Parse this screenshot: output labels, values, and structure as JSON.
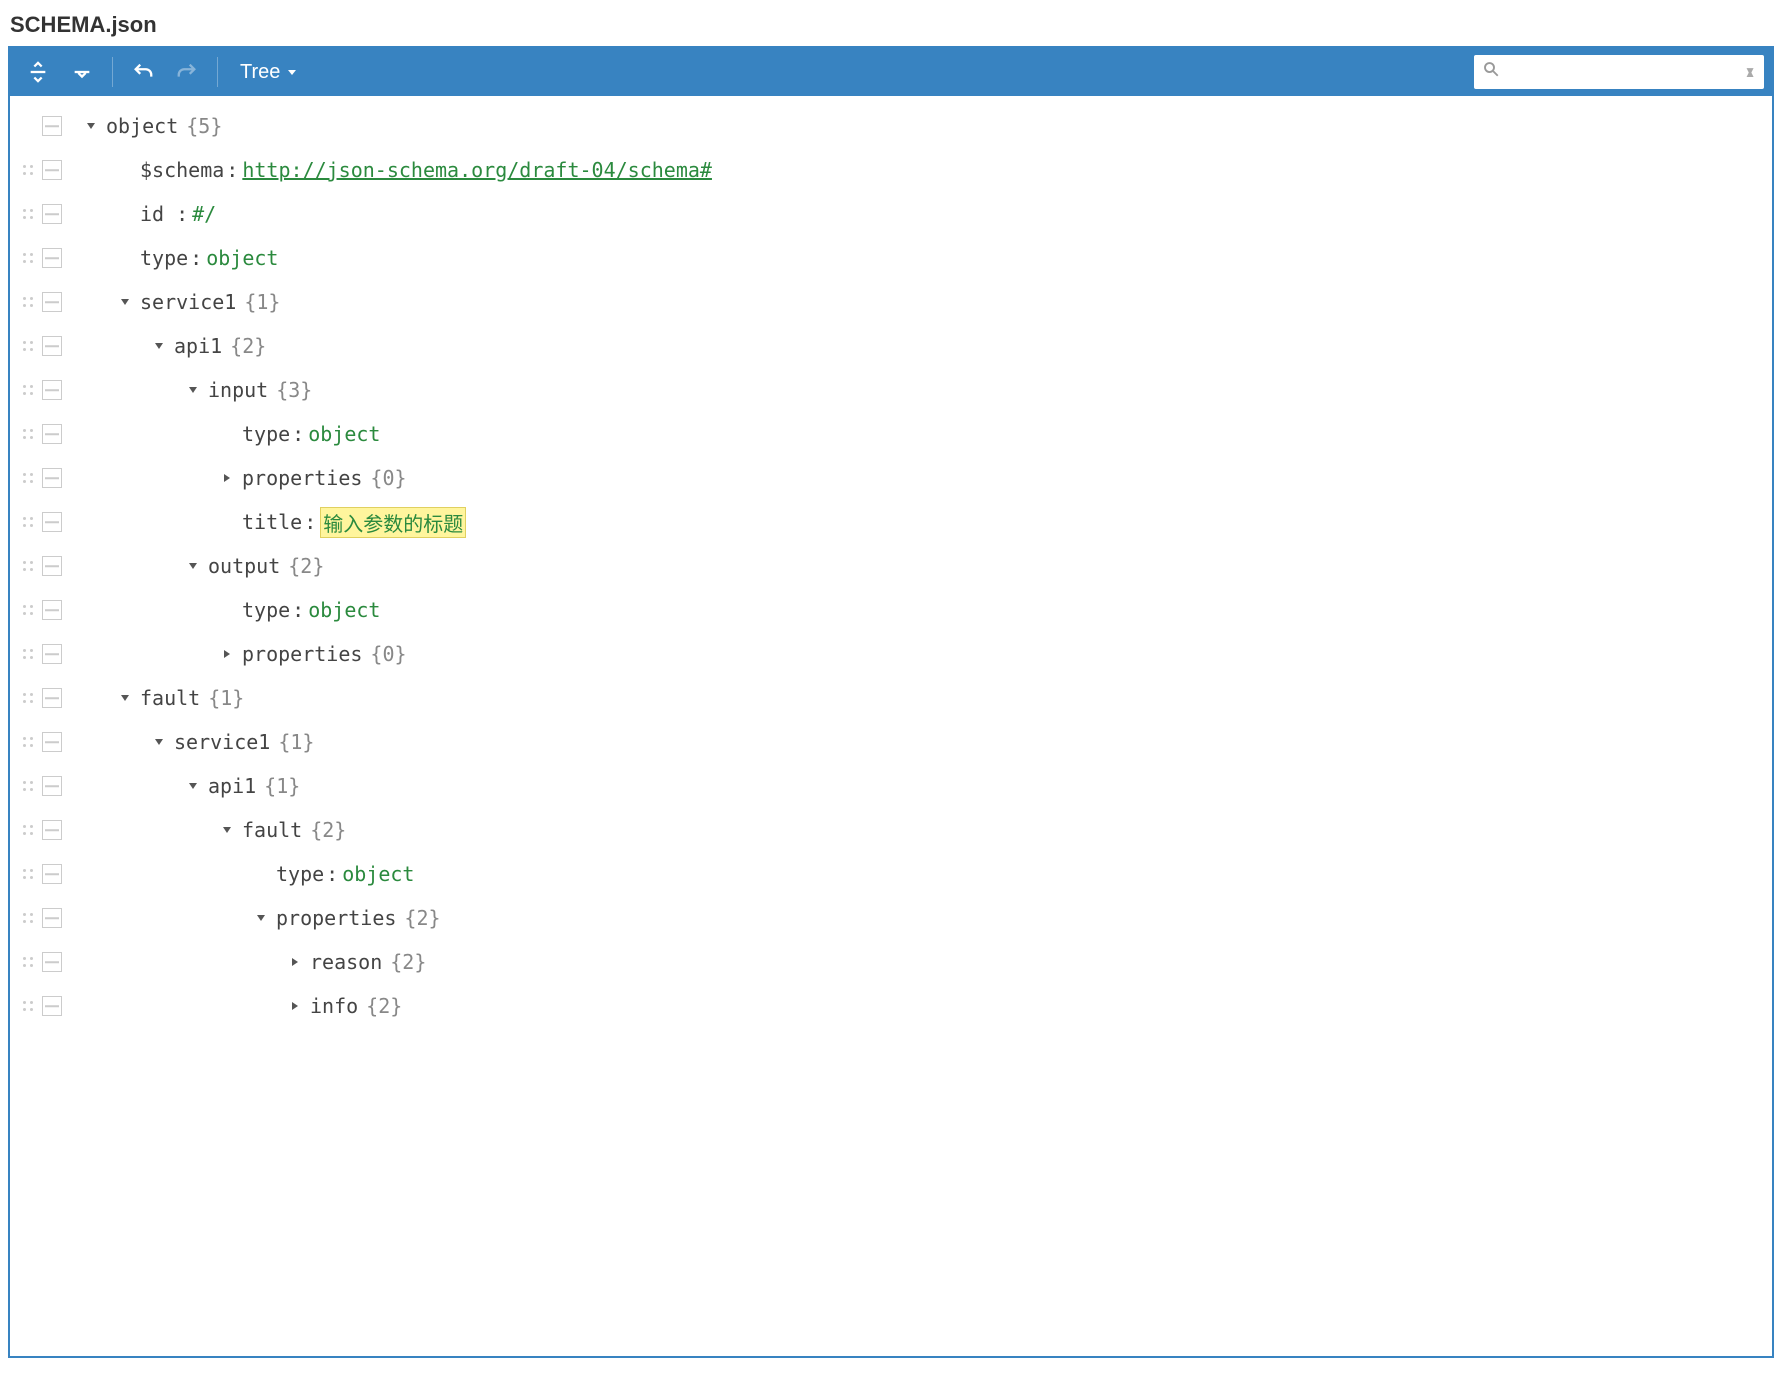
{
  "title": "SCHEMA.json",
  "toolbar": {
    "mode_label": "Tree",
    "search_placeholder": ""
  },
  "rows": [
    {
      "drag": false,
      "indent": 0,
      "caret": "down",
      "key": "object",
      "count": "{5}"
    },
    {
      "drag": true,
      "indent": 1,
      "caret": "none",
      "key": "$schema",
      "colon": true,
      "value": "http://json-schema.org/draft-04/schema#",
      "value_style": "url"
    },
    {
      "drag": true,
      "indent": 1,
      "caret": "none",
      "key": "id",
      "key_pad": true,
      "colon": true,
      "value": "#/",
      "value_style": "string"
    },
    {
      "drag": true,
      "indent": 1,
      "caret": "none",
      "key": "type",
      "colon": true,
      "value": "object",
      "value_style": "string"
    },
    {
      "drag": true,
      "indent": 1,
      "caret": "down",
      "key": "service1",
      "count": "{1}"
    },
    {
      "drag": true,
      "indent": 2,
      "caret": "down",
      "key": "api1",
      "count": "{2}"
    },
    {
      "drag": true,
      "indent": 3,
      "caret": "down",
      "key": "input",
      "count": "{3}"
    },
    {
      "drag": true,
      "indent": 4,
      "caret": "none",
      "key": "type",
      "colon": true,
      "value": "object",
      "value_style": "string"
    },
    {
      "drag": true,
      "indent": 4,
      "caret": "right",
      "key": "properties",
      "count": "{0}"
    },
    {
      "drag": true,
      "indent": 4,
      "caret": "none",
      "key": "title",
      "colon": true,
      "value": "输入参数的标题",
      "value_style": "string",
      "highlight": true
    },
    {
      "drag": true,
      "indent": 3,
      "caret": "down",
      "key": "output",
      "count": "{2}"
    },
    {
      "drag": true,
      "indent": 4,
      "caret": "none",
      "key": "type",
      "colon": true,
      "value": "object",
      "value_style": "string"
    },
    {
      "drag": true,
      "indent": 4,
      "caret": "right",
      "key": "properties",
      "count": "{0}"
    },
    {
      "drag": true,
      "indent": 1,
      "caret": "down",
      "key": "fault",
      "count": "{1}"
    },
    {
      "drag": true,
      "indent": 2,
      "caret": "down",
      "key": "service1",
      "count": "{1}"
    },
    {
      "drag": true,
      "indent": 3,
      "caret": "down",
      "key": "api1",
      "count": "{1}"
    },
    {
      "drag": true,
      "indent": 4,
      "caret": "down",
      "key": "fault",
      "count": "{2}"
    },
    {
      "drag": true,
      "indent": 5,
      "caret": "none",
      "key": "type",
      "colon": true,
      "value": "object",
      "value_style": "string"
    },
    {
      "drag": true,
      "indent": 5,
      "caret": "down",
      "key": "properties",
      "count": "{2}"
    },
    {
      "drag": true,
      "indent": 6,
      "caret": "right",
      "key": "reason",
      "count": "{2}"
    },
    {
      "drag": true,
      "indent": 6,
      "caret": "right",
      "key": "info",
      "count": "{2}"
    }
  ]
}
